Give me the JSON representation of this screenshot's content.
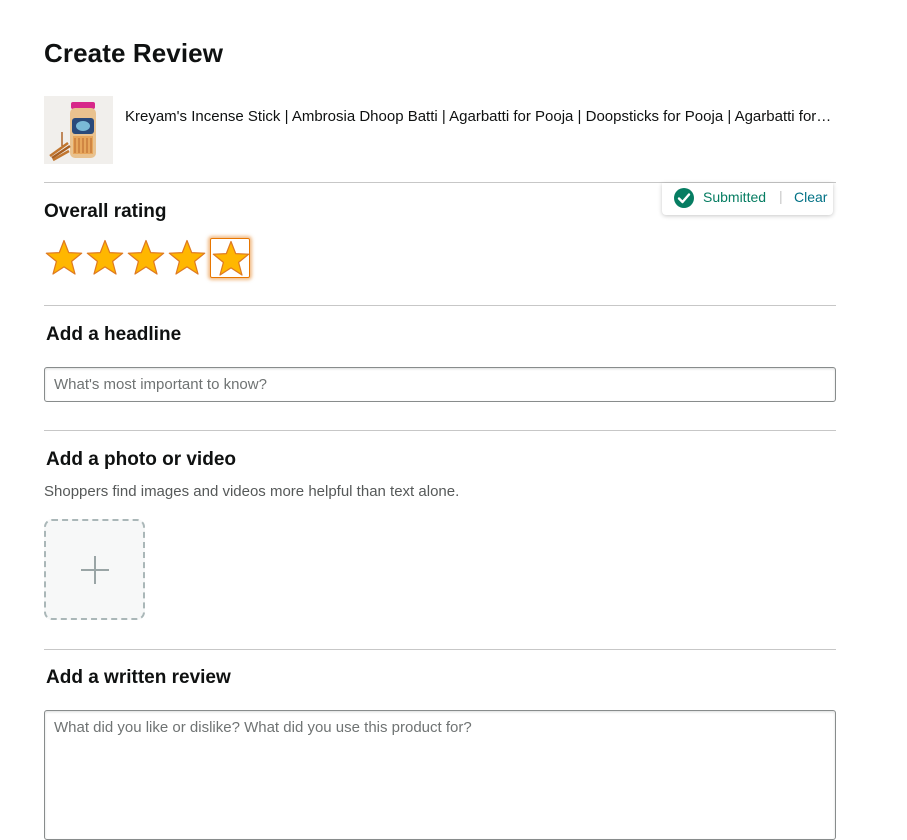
{
  "page": {
    "title": "Create Review"
  },
  "product": {
    "title": "Kreyam's Incense Stick | Ambrosia Dhoop Batti | Agarbatti for Pooja | Doopsticks for Pooja | Agarbatti for Home | Dhoop Sticks",
    "image_icon": "product-image-icon"
  },
  "rating": {
    "title": "Overall rating",
    "value": 5,
    "max": 5,
    "status": "Submitted",
    "separator": "|",
    "clear_label": "Clear"
  },
  "headline": {
    "title": "Add a headline",
    "placeholder": "What's most important to know?",
    "value": ""
  },
  "media": {
    "title": "Add a photo or video",
    "helper": "Shoppers find images and videos more helpful than text alone.",
    "add_icon": "plus-icon"
  },
  "written": {
    "title": "Add a written review",
    "placeholder": "What did you like or dislike? What did you use this product for?",
    "value": ""
  },
  "colors": {
    "star_fill": "#ffb700",
    "star_stroke": "#de7921",
    "submitted": "#067d62",
    "link": "#007185",
    "focus": "#e77600"
  }
}
